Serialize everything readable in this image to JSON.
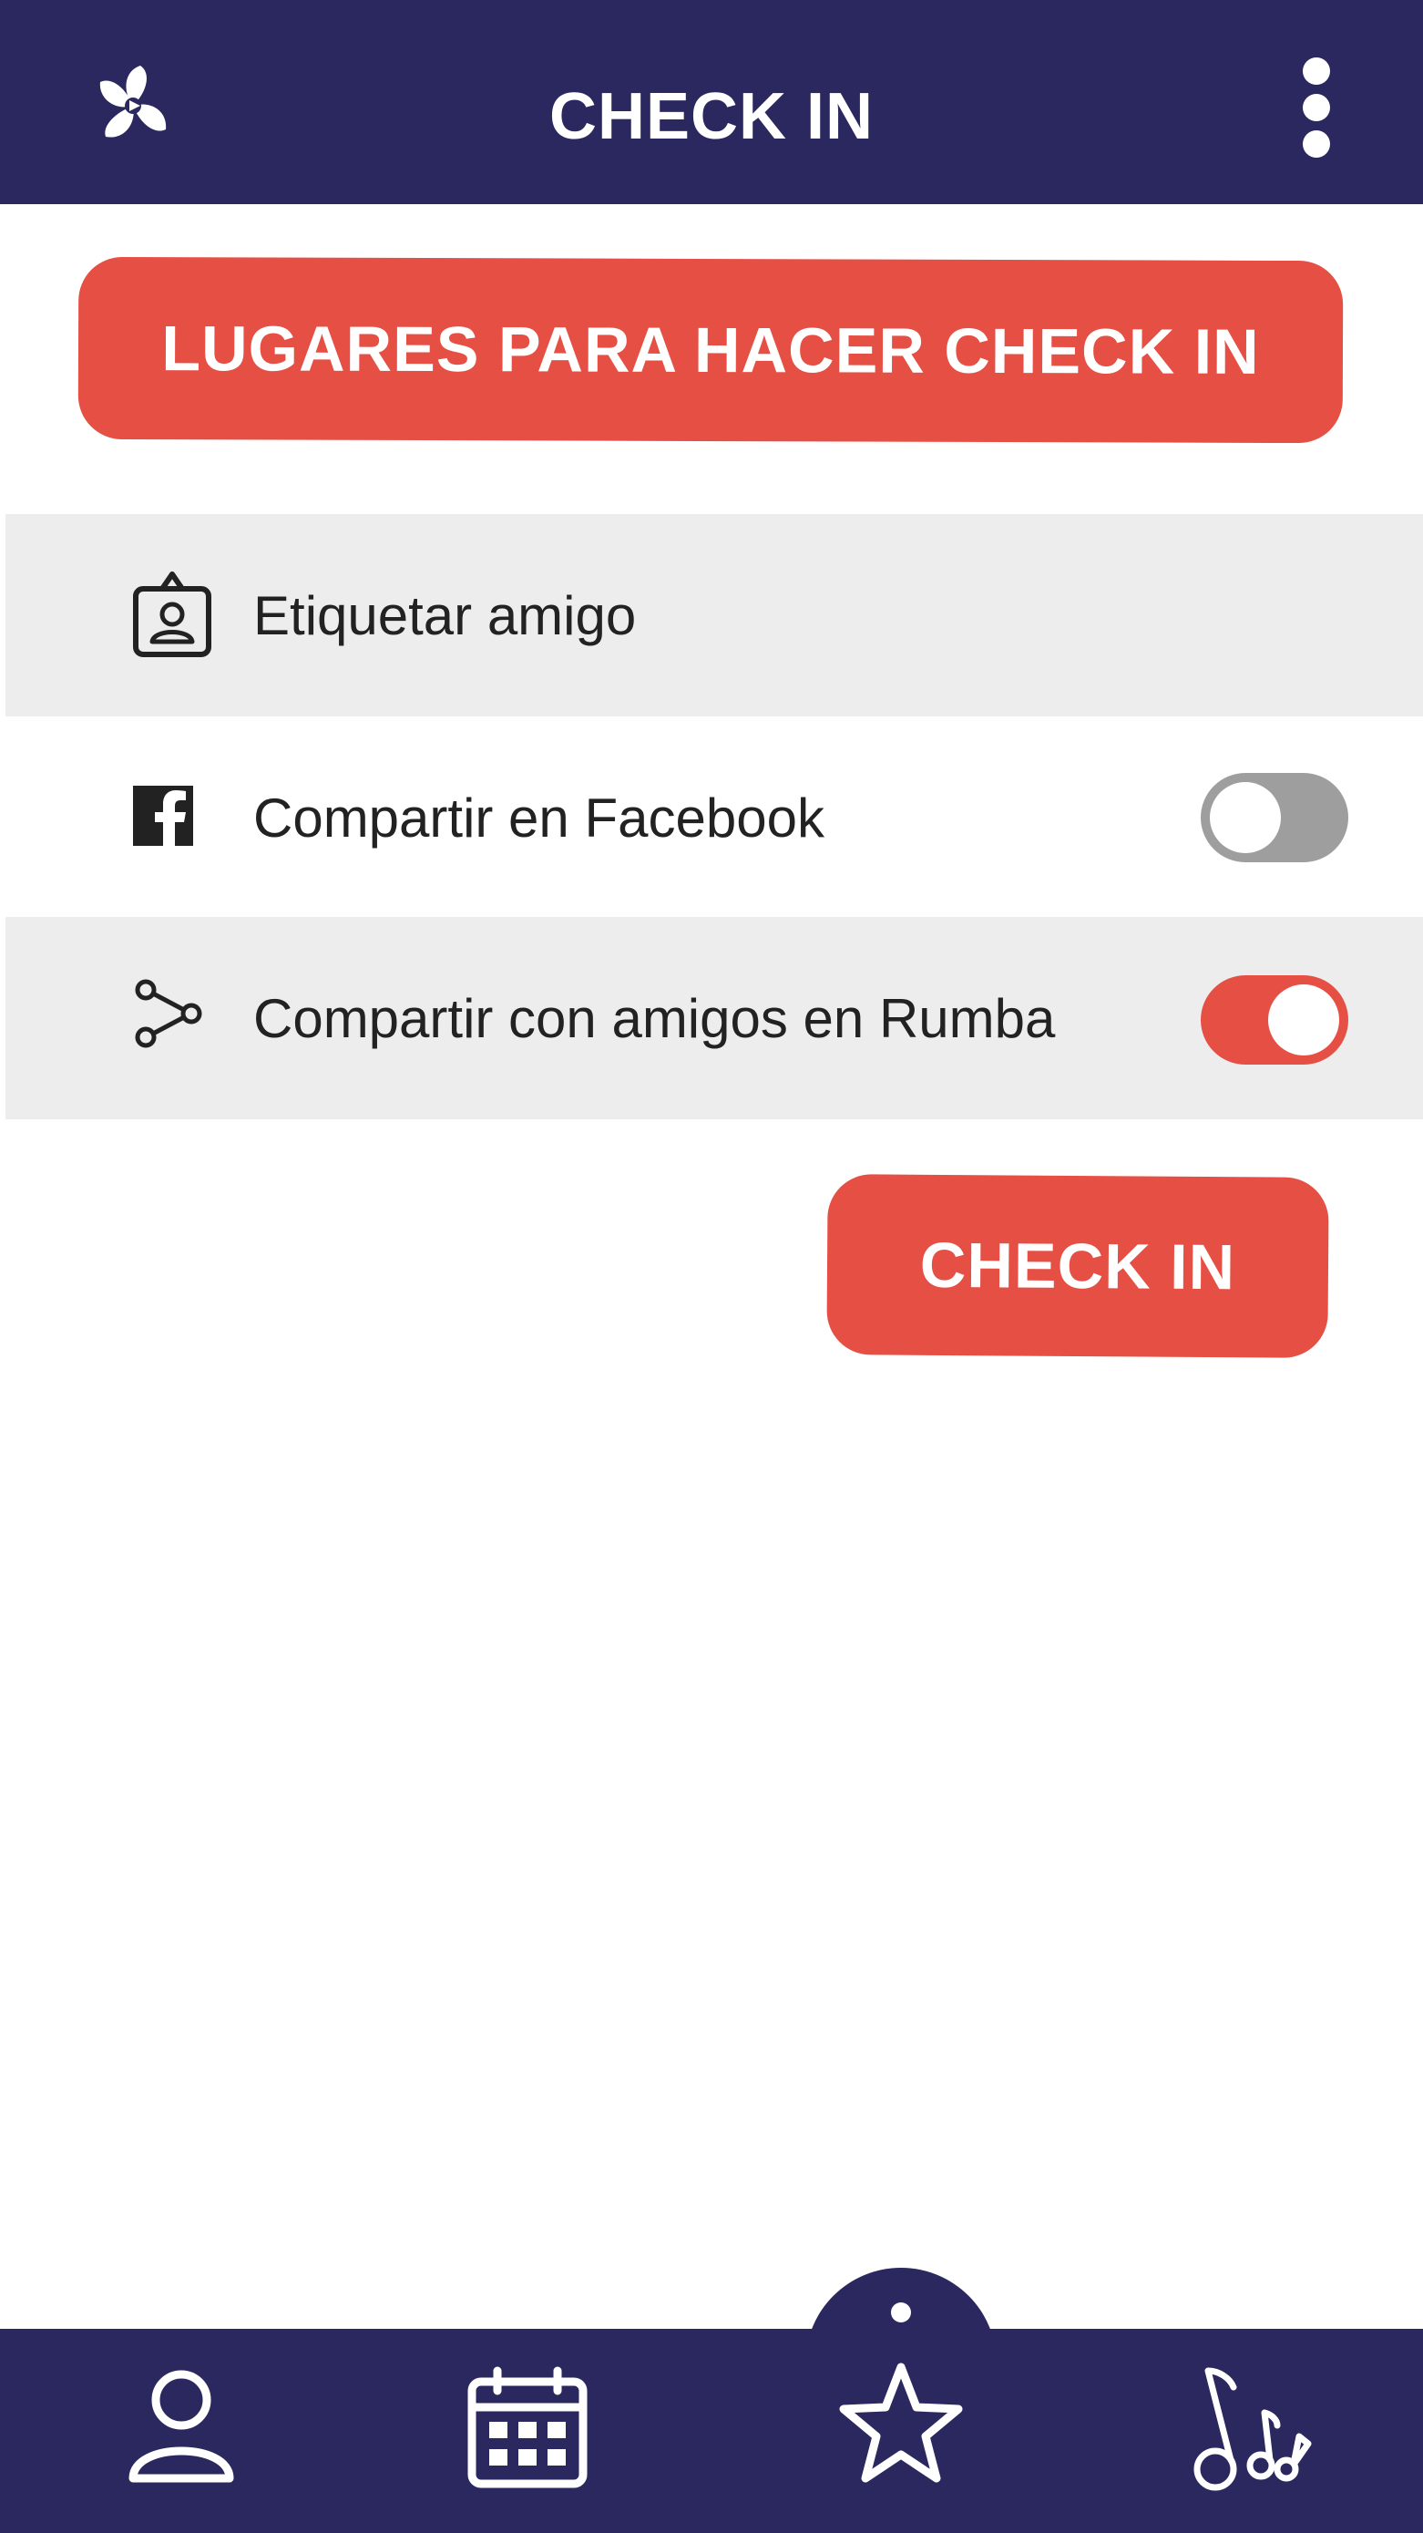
{
  "header": {
    "title": "CHECK IN",
    "logo_icon": "pinwheel-logo-icon",
    "menu_icon": "more-vertical-icon"
  },
  "places_button": {
    "label": "LUGARES PARA HACER CHECK IN"
  },
  "options": [
    {
      "label": "Etiquetar amigo",
      "icon": "contact-card-icon"
    },
    {
      "label": "Compartir en Facebook",
      "icon": "facebook-icon",
      "toggle_on": false
    },
    {
      "label": "Compartir con amigos en Rumba",
      "icon": "share-icon",
      "toggle_on": true
    }
  ],
  "checkin_button": {
    "label": "CHECK IN"
  },
  "bottom_nav": {
    "items": [
      {
        "icon": "user-icon"
      },
      {
        "icon": "calendar-icon"
      },
      {
        "icon": "star-icon",
        "active": true
      },
      {
        "icon": "music-notes-icon"
      }
    ]
  },
  "colors": {
    "primary": "#2a285e",
    "accent": "#e54f44",
    "row_background": "#ededed",
    "toggle_off": "#9e9e9e"
  }
}
